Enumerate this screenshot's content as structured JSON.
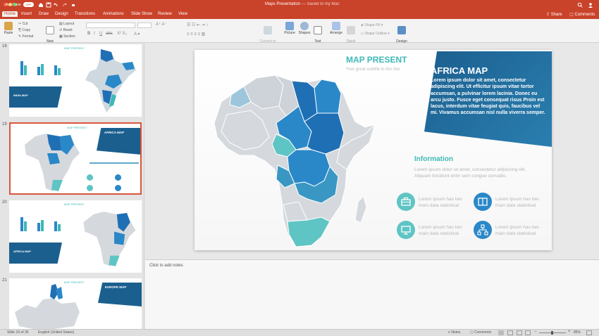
{
  "window": {
    "autosave_label": "AutoSave",
    "autosave_state": "OFF",
    "title": "Maps Presentation",
    "saved_status": "— Saved to my Mac"
  },
  "ribbon_tabs": [
    "Home",
    "Insert",
    "Draw",
    "Design",
    "Transitions",
    "Animations",
    "Slide Show",
    "Review",
    "View"
  ],
  "share_label": "Share",
  "comments_label": "Comments",
  "ribbon": {
    "paste": "Paste",
    "cut": "Cut",
    "copy": "Copy",
    "format": "Format",
    "new_slide": "New\nSlide",
    "layout": "Layout",
    "reset": "Reset",
    "section": "Section",
    "convert_smartart": "Convert to\nSmartArt",
    "picture": "Picture",
    "shapes": "Shapes",
    "text_box": "Text\nBox",
    "arrange": "Arrange",
    "quick_styles": "Quick\nStyles",
    "shape_fill": "Shape Fill",
    "shape_outline": "Shape Outline",
    "design_ideas": "Design\nIdeas"
  },
  "slide": {
    "heading": "MAP PRESENT",
    "subheading": "Your great subtitle in this line",
    "banner_title": "AFRICA MAP",
    "banner_text": "Lorem ipsum dolor sit amet, consectetur adipiscing elit. Ut efficitur ipsum vitae tortor accumsan, a pulvinar lorem lacinia. Donec eu arcu justo. Fusce eget consequat risus Proin est lacus, interdum vitae feugiat quis, faucibus vel mi.  Vivamus accumsan nisl nulla viverra semper.",
    "info_title": "Information",
    "info_text": "Lorem ipsum dolor sit amet, consectetur adipiscing elit. Aliquam tincidunt enim sem congue convallis.",
    "stats": [
      {
        "icon": "briefcase-icon",
        "text": "Lorem ipsum has two main data statistical"
      },
      {
        "icon": "book-icon",
        "text": "Lorem ipsum has two main data statistical"
      },
      {
        "icon": "monitor-icon",
        "text": "Lorem ipsum has two main data statistical"
      },
      {
        "icon": "hierarchy-icon",
        "text": "Lorem ipsum has two main data statistical"
      }
    ]
  },
  "thumbnails": [
    {
      "number": "18",
      "heading": "MAP PRESENT",
      "title": "INDIA MAP"
    },
    {
      "number": "19",
      "heading": "MAP PRESENT",
      "title": "AFRICA MAP"
    },
    {
      "number": "20",
      "heading": "MAP PRESENT",
      "title": "AFRICA MAP"
    },
    {
      "number": "21",
      "heading": "MAP PRESENT",
      "title": "EUROPE MAP"
    }
  ],
  "notes_placeholder": "Click to add notes",
  "status": {
    "slide_info": "Slide 19 of 35",
    "language": "English (United States)",
    "notes": "Notes",
    "comments": "Comments",
    "zoom": "85%"
  },
  "colors": {
    "accent_red": "#c9422a",
    "teal": "#3fb8b8",
    "blue_dark": "#1f6fb5",
    "blue_mid": "#2a88c8",
    "navy": "#1b5f8f"
  }
}
